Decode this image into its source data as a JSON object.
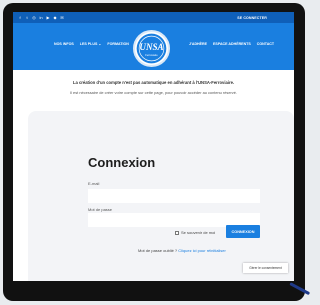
{
  "topbar": {
    "social_icons": [
      "facebook-icon",
      "twitter-icon",
      "instagram-icon",
      "linkedin-icon",
      "youtube-icon",
      "rss-icon",
      "email-icon"
    ],
    "social_glyphs": [
      "f",
      "t",
      "◎",
      "in",
      "▶",
      "◆",
      "✉"
    ],
    "connect_label": "SE CONNECTER"
  },
  "nav": {
    "left": [
      "NOS INFOS",
      "LES PLUS ⌄",
      "FORMATION"
    ],
    "right": [
      "J'ADHÈRE",
      "ESPACE ADHÉRENTS",
      "CONTACT"
    ]
  },
  "logo": {
    "text": "UNSA",
    "sub": "Ferroviaire"
  },
  "notice": {
    "line1": "La création d'un compte n'est pas automatique en adhérant à l'UNSA-Ferroviaire.",
    "line2": "Il est nécessaire de créer votre compte sur cette page, pour pouvoir accéder au contenu réservé."
  },
  "login": {
    "title": "Connexion",
    "email_label": "E-mail",
    "email_value": "",
    "password_label": "Mot de passe",
    "password_value": "",
    "remember_label": "Se souvenir de moi",
    "submit_label": "CONNEXION",
    "forgot_text": "Mot de passe oublié ?",
    "forgot_link": "Cliquez ici pour réinitialiser"
  },
  "cookie": {
    "label": "Gérer le consentement"
  },
  "colors": {
    "brand_blue": "#1a7fe0",
    "top_bar": "#0f5fb8",
    "panel": "#f3f4f7"
  }
}
